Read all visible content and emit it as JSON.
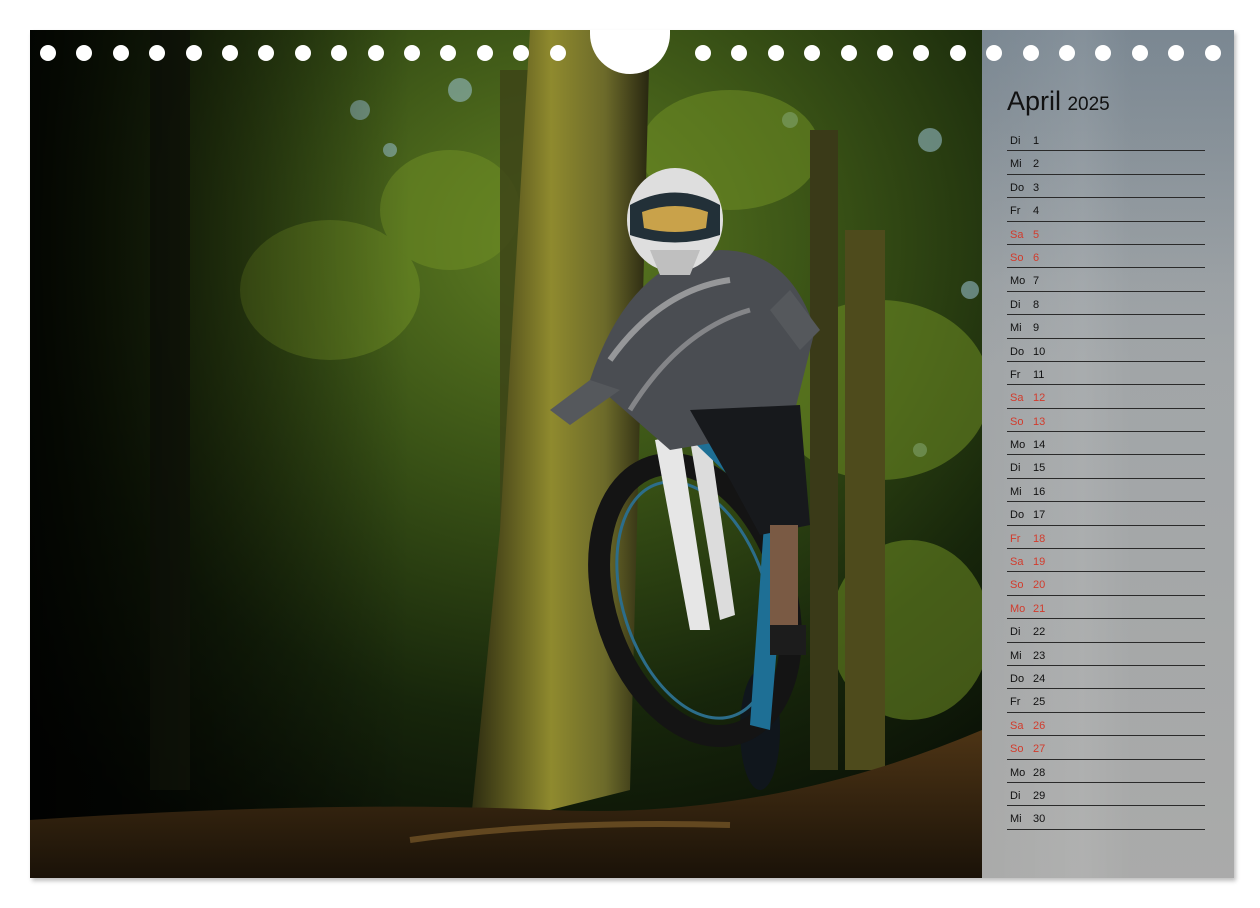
{
  "calendar": {
    "month": "April",
    "year": "2025",
    "days": [
      {
        "wd": "Di",
        "d": "1",
        "holiday": false
      },
      {
        "wd": "Mi",
        "d": "2",
        "holiday": false
      },
      {
        "wd": "Do",
        "d": "3",
        "holiday": false
      },
      {
        "wd": "Fr",
        "d": "4",
        "holiday": false
      },
      {
        "wd": "Sa",
        "d": "5",
        "holiday": true
      },
      {
        "wd": "So",
        "d": "6",
        "holiday": true
      },
      {
        "wd": "Mo",
        "d": "7",
        "holiday": false
      },
      {
        "wd": "Di",
        "d": "8",
        "holiday": false
      },
      {
        "wd": "Mi",
        "d": "9",
        "holiday": false
      },
      {
        "wd": "Do",
        "d": "10",
        "holiday": false
      },
      {
        "wd": "Fr",
        "d": "11",
        "holiday": false
      },
      {
        "wd": "Sa",
        "d": "12",
        "holiday": true
      },
      {
        "wd": "So",
        "d": "13",
        "holiday": true
      },
      {
        "wd": "Mo",
        "d": "14",
        "holiday": false
      },
      {
        "wd": "Di",
        "d": "15",
        "holiday": false
      },
      {
        "wd": "Mi",
        "d": "16",
        "holiday": false
      },
      {
        "wd": "Do",
        "d": "17",
        "holiday": false
      },
      {
        "wd": "Fr",
        "d": "18",
        "holiday": true
      },
      {
        "wd": "Sa",
        "d": "19",
        "holiday": true
      },
      {
        "wd": "So",
        "d": "20",
        "holiday": true
      },
      {
        "wd": "Mo",
        "d": "21",
        "holiday": true
      },
      {
        "wd": "Di",
        "d": "22",
        "holiday": false
      },
      {
        "wd": "Mi",
        "d": "23",
        "holiday": false
      },
      {
        "wd": "Do",
        "d": "24",
        "holiday": false
      },
      {
        "wd": "Fr",
        "d": "25",
        "holiday": false
      },
      {
        "wd": "Sa",
        "d": "26",
        "holiday": true
      },
      {
        "wd": "So",
        "d": "27",
        "holiday": true
      },
      {
        "wd": "Mo",
        "d": "28",
        "holiday": false
      },
      {
        "wd": "Di",
        "d": "29",
        "holiday": false
      },
      {
        "wd": "Mi",
        "d": "30",
        "holiday": false
      }
    ]
  },
  "colors": {
    "weekday_text": "#111111",
    "holiday_text": "#d23b2c",
    "sidebar_bg": "#b2b2b2"
  }
}
